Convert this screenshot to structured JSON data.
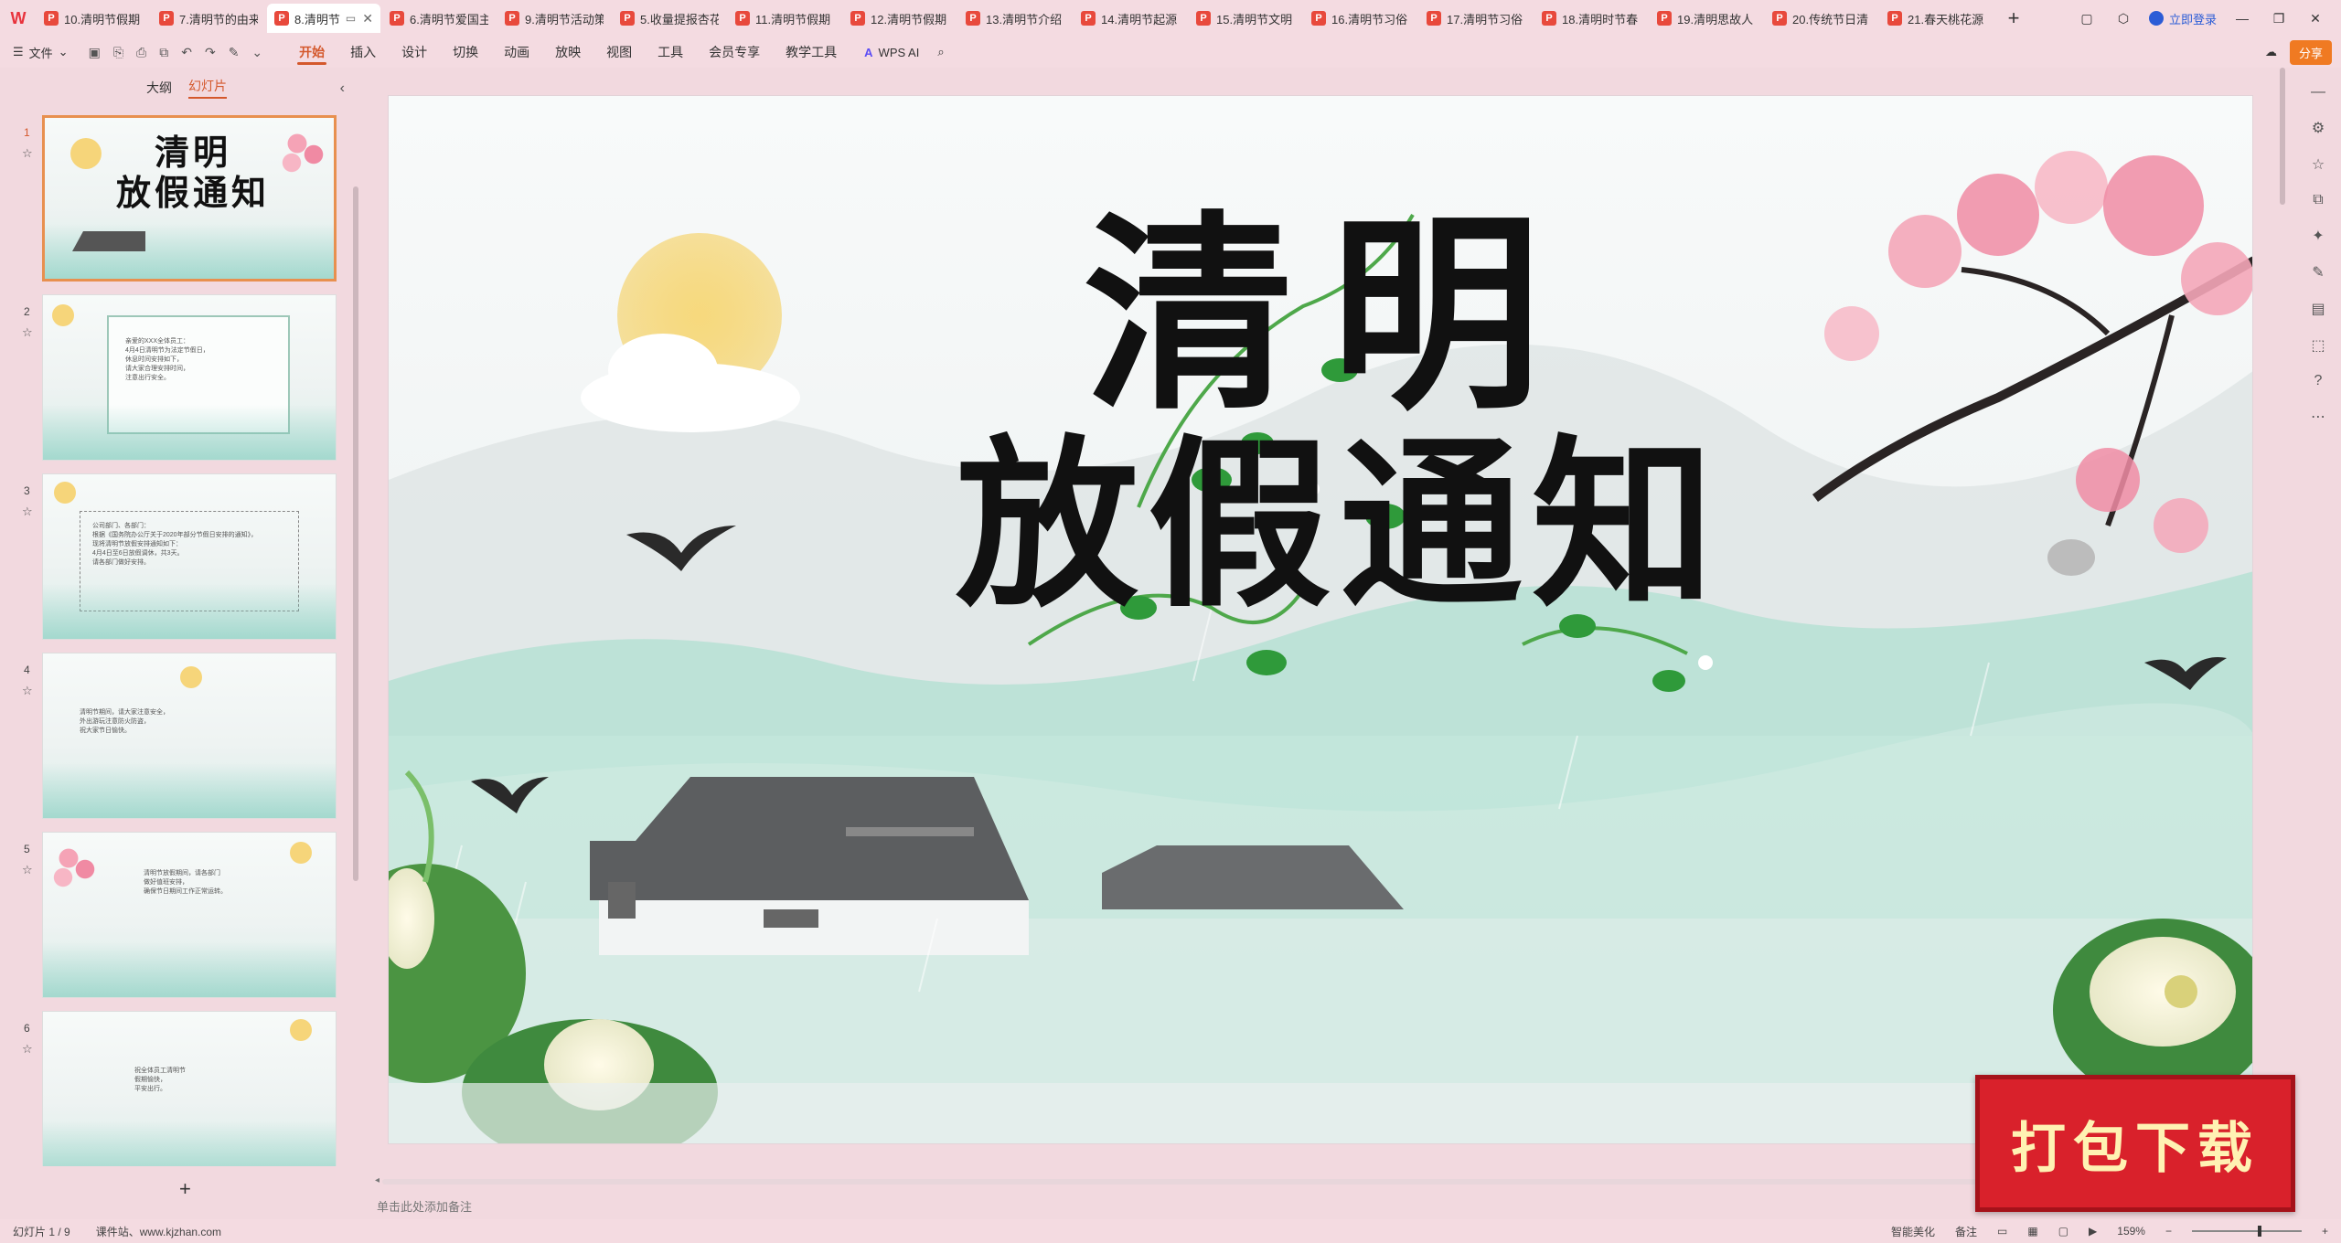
{
  "tabs": [
    {
      "label": "10.清明节假期"
    },
    {
      "label": "7.清明节的由来"
    },
    {
      "label": "8.清明节",
      "active": true
    },
    {
      "label": "6.清明节爱国主"
    },
    {
      "label": "9.清明节活动策"
    },
    {
      "label": "5.收量提报杏花"
    },
    {
      "label": "11.清明节假期"
    },
    {
      "label": "12.清明节假期"
    },
    {
      "label": "13.清明节介绍"
    },
    {
      "label": "14.清明节起源"
    },
    {
      "label": "15.清明节文明"
    },
    {
      "label": "16.清明节习俗"
    },
    {
      "label": "17.清明节习俗"
    },
    {
      "label": "18.清明时节春"
    },
    {
      "label": "19.清明思故人"
    },
    {
      "label": "20.传统节日清"
    },
    {
      "label": "21.春天桃花源"
    }
  ],
  "tabbar": {
    "login": "立即登录",
    "add": "+"
  },
  "menu": {
    "file": "文件",
    "items": [
      "开始",
      "插入",
      "设计",
      "切换",
      "动画",
      "放映",
      "视图",
      "工具",
      "会员专享",
      "教学工具"
    ],
    "active": "开始",
    "wps_ai": "WPS AI",
    "share": "分享"
  },
  "panel": {
    "tab_outline": "大纲",
    "tab_slides": "幻灯片",
    "add": "+"
  },
  "thumbs": [
    {
      "num": "1",
      "title": "清明\n放假通知"
    },
    {
      "num": "2",
      "text": "亲爱的XXX全体员工：\n4月4日清明节为法定节假日，\n休息时间安排如下，\n请大家合理安排时间，\n注意出行安全。"
    },
    {
      "num": "3",
      "text": "公司部门、各部门：\n根据《国务院办公厅关于2020年部分节假日安排的通知》，\n现将清明节放假安排通知如下：\n4月4日至6日放假调休，共3天。\n请各部门做好安排。"
    },
    {
      "num": "4",
      "text": "清明节期间，请大家注意安全，\n外出游玩注意防火防盗，\n祝大家节日愉快。"
    },
    {
      "num": "5",
      "text": "清明节放假期间，请各部门\n做好值班安排，\n确保节日期间工作正常运转。"
    },
    {
      "num": "6",
      "text": "祝全体员工清明节\n假期愉快，\n平安出行。"
    }
  ],
  "slide": {
    "title_line1": "清明",
    "title_line2": "放假通知"
  },
  "notes_placeholder": "单击此处添加备注",
  "status": {
    "slide_count": "幻灯片 1 / 9",
    "site": "课件站、www.kjzhan.com",
    "smart": "智能美化",
    "notes": "备注",
    "zoom": "159%"
  },
  "badge": "打包下载",
  "colors": {
    "accent": "#d4582c",
    "share": "#f07a22",
    "badge": "#d9212b"
  }
}
